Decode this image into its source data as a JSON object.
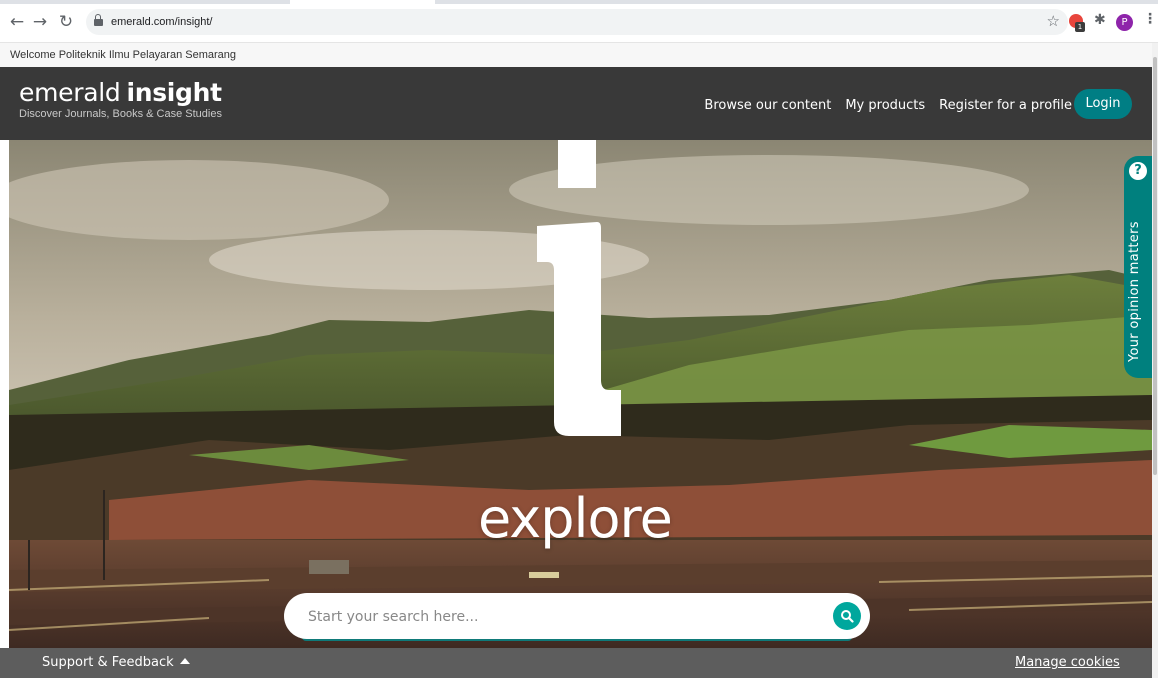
{
  "browser": {
    "url": "emerald.com/insight/",
    "back_icon": "back-arrow-icon",
    "forward_icon": "forward-arrow-icon",
    "reload_icon": "reload-icon",
    "extension_badge": "1",
    "profile_initial": "P"
  },
  "welcome": {
    "text": "Welcome Politeknik Ilmu Pelayaran Semarang"
  },
  "header": {
    "logo_light": "emerald",
    "logo_bold": "insight",
    "tagline": "Discover Journals, Books & Case Studies",
    "nav": [
      "Browse our content",
      "My products",
      "Register for a profile"
    ],
    "login_label": "Login"
  },
  "hero": {
    "headline": "explore",
    "search_placeholder": "Start your search here..."
  },
  "feedback_tab": {
    "label": "Your opinion matters"
  },
  "footer": {
    "support_label": "Support & Feedback",
    "cookies_label": "Manage cookies"
  },
  "colors": {
    "header_bg": "#393939",
    "accent_teal": "#007e84",
    "footer_bg": "#5d5d5d"
  }
}
